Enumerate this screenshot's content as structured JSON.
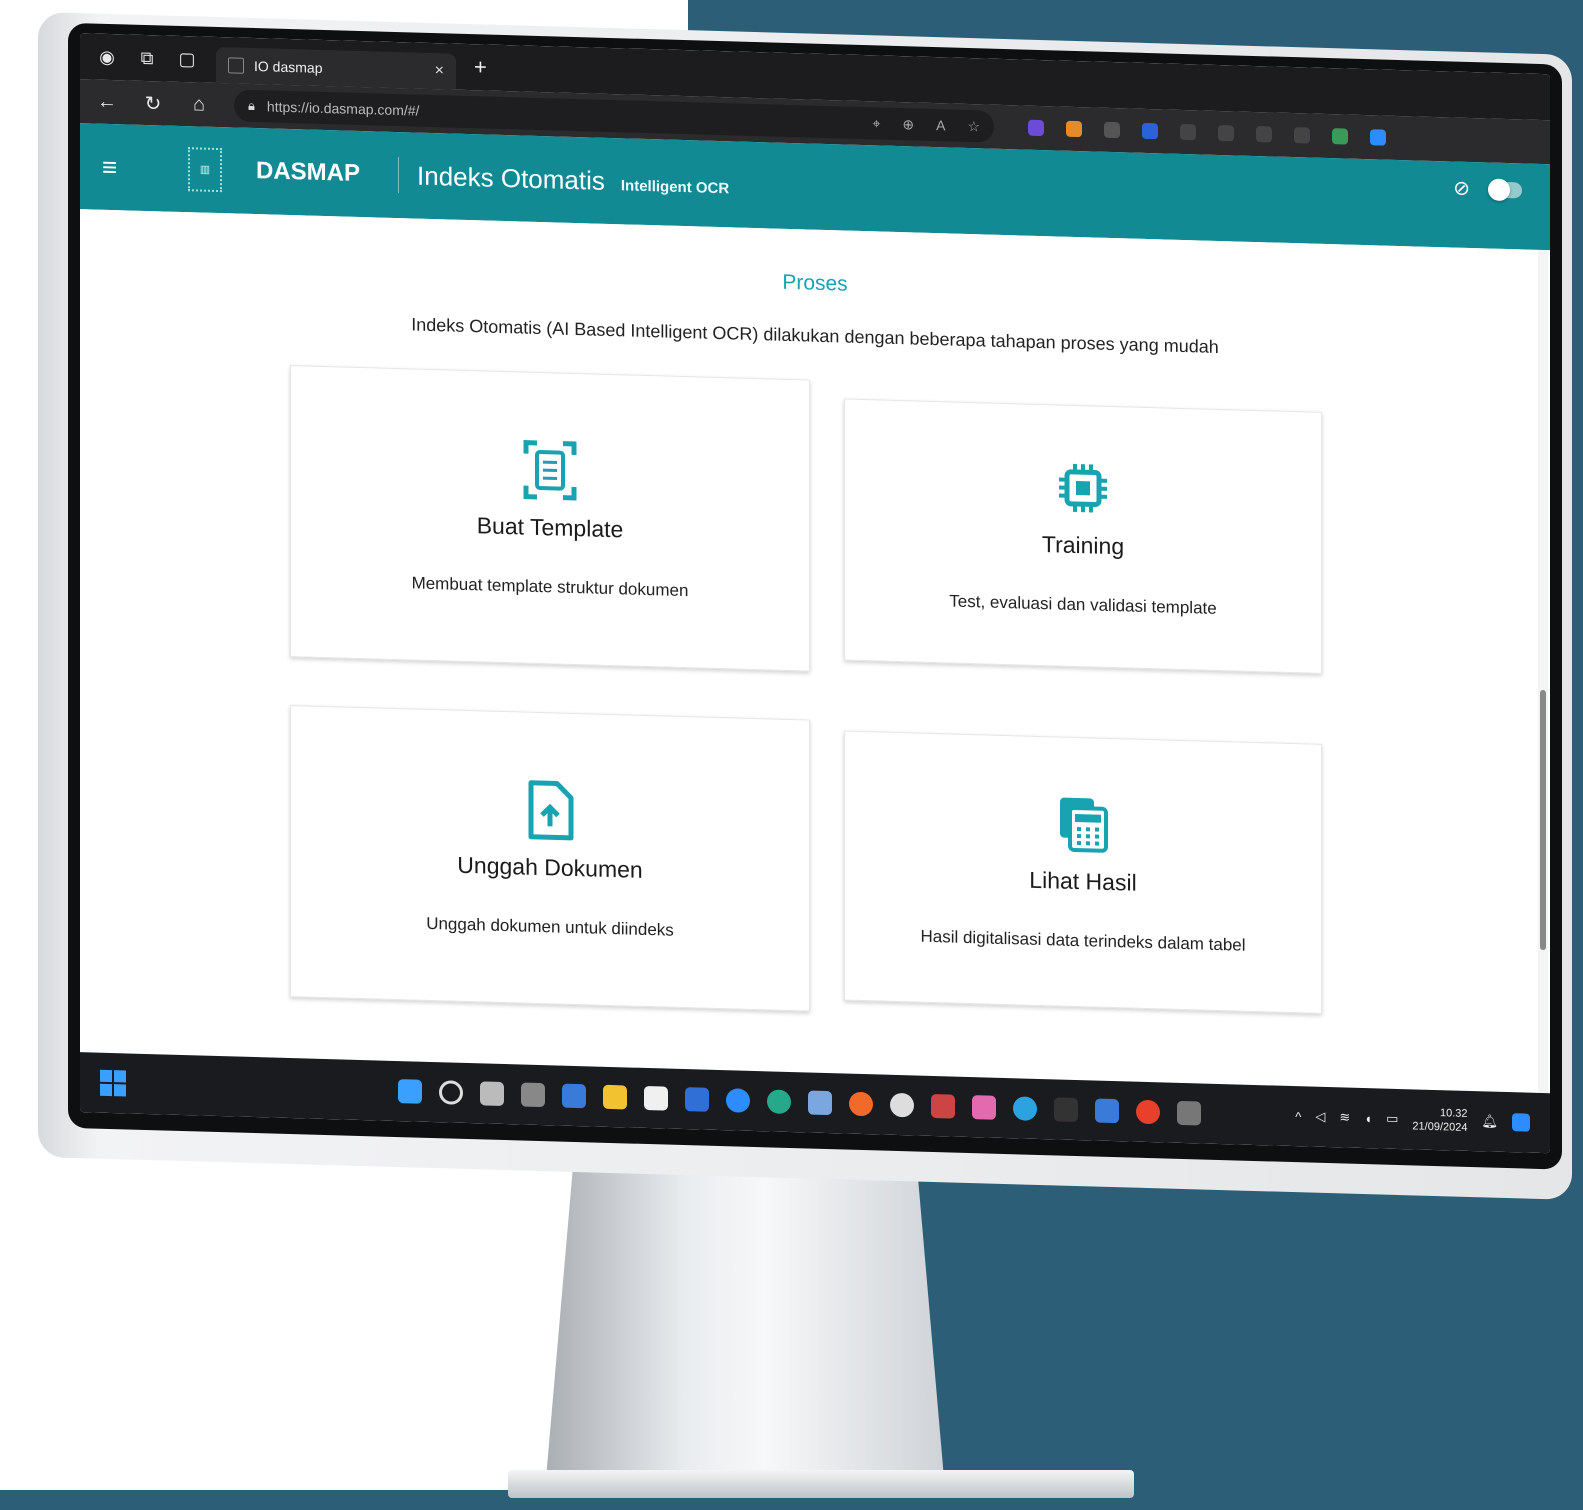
{
  "browser": {
    "tab_title": "IO dasmap",
    "tab_close": "×",
    "new_tab": "+",
    "url": "https://io.dasmap.com/#/",
    "window_minimize": "–",
    "window_restore": "▢",
    "window_close": "✕"
  },
  "app": {
    "brand": "DASMAP",
    "title": "Indeks Otomatis",
    "subtitle": "Intelligent OCR",
    "accent_color": "#128a93",
    "title_color": "#17a3b0"
  },
  "content": {
    "section_title": "Proses",
    "intro": "Indeks Otomatis (AI Based Intelligent OCR) dilakukan dengan beberapa tahapan proses yang mudah",
    "cards": [
      {
        "title": "Buat Template",
        "description": "Membuat template struktur dokumen",
        "icon": "document-scan-icon"
      },
      {
        "title": "Training",
        "description": "Test, evaluasi dan validasi template",
        "icon": "chip-icon"
      },
      {
        "title": "Unggah Dokumen",
        "description": "Unggah dokumen untuk diindeks",
        "icon": "file-upload-icon"
      },
      {
        "title": "Lihat Hasil",
        "description": "Hasil digitalisasi data terindeks dalam tabel",
        "icon": "calculator-table-icon"
      }
    ]
  },
  "taskbar": {
    "time": "10.32",
    "date": "21/09/2024"
  }
}
